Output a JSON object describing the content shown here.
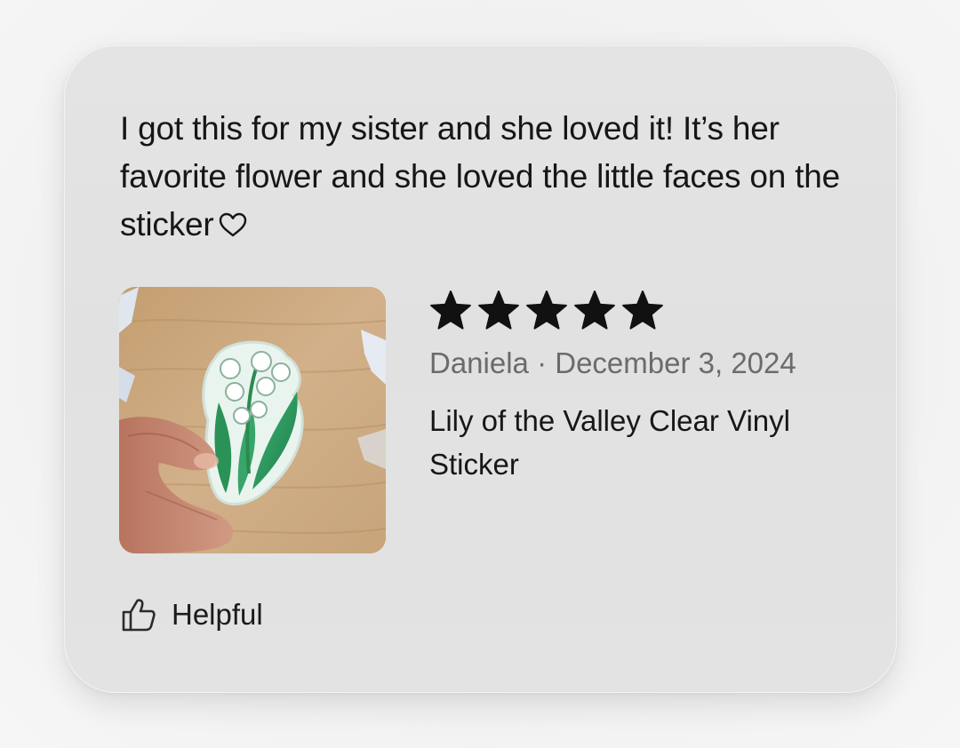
{
  "review": {
    "text": "I got this for my sister and she loved it! It’s her favorite flower and she loved the little faces on the sticker",
    "rating": 5,
    "max_rating": 5,
    "reviewer": "Daniela",
    "separator": " · ",
    "date": "December 3, 2024",
    "product_title": "Lily of the Valley Clear Vinyl Sticker",
    "helpful_label": "Helpful"
  },
  "icons": {
    "heart": "heart-outline-icon",
    "star": "star-filled-icon",
    "thumb": "thumbs-up-outline-icon"
  },
  "colors": {
    "star_fill": "#111111",
    "text_primary": "#161616",
    "text_secondary": "#6b6b6b"
  }
}
